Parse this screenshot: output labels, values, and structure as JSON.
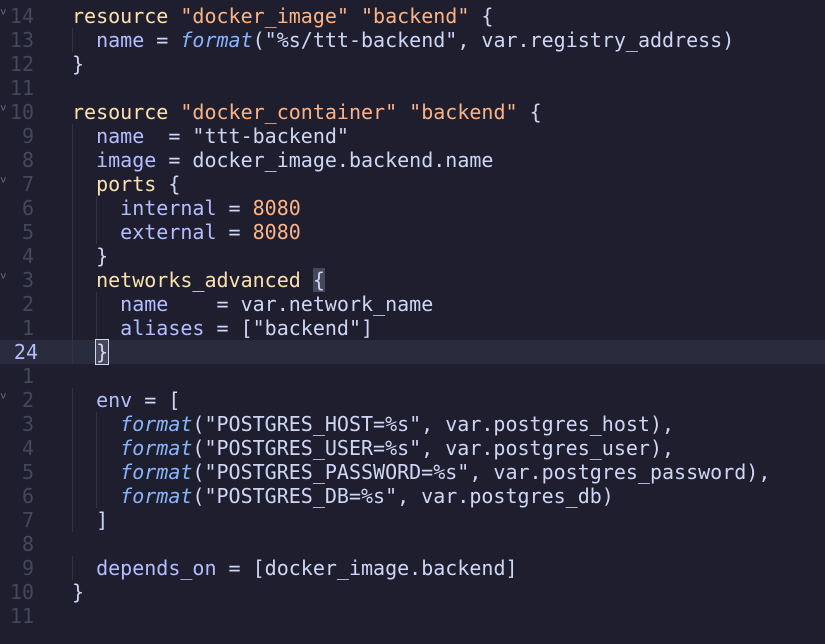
{
  "editor": {
    "current_line_index": 14,
    "lines": [
      {
        "num": "14",
        "fold": true,
        "indent": 0,
        "tokens": [
          {
            "t": "resource",
            "c": "keyword"
          },
          {
            "t": " "
          },
          {
            "t": "\"docker_image\"",
            "c": "string"
          },
          {
            "t": " "
          },
          {
            "t": "\"backend\"",
            "c": "string"
          },
          {
            "t": " {"
          }
        ]
      },
      {
        "num": "13",
        "fold": false,
        "indent": 1,
        "tokens": [
          {
            "t": "name",
            "c": "property"
          },
          {
            "t": " = "
          },
          {
            "t": "format",
            "c": "function"
          },
          {
            "t": "(\"%s/ttt-backend\", var.registry_address)"
          }
        ]
      },
      {
        "num": "12",
        "fold": false,
        "indent": 0,
        "tokens": [
          {
            "t": "}"
          }
        ]
      },
      {
        "num": "11",
        "fold": false,
        "indent": 0,
        "tokens": []
      },
      {
        "num": "10",
        "fold": true,
        "indent": 0,
        "tokens": [
          {
            "t": "resource",
            "c": "keyword"
          },
          {
            "t": " "
          },
          {
            "t": "\"docker_container\"",
            "c": "string"
          },
          {
            "t": " "
          },
          {
            "t": "\"backend\"",
            "c": "string"
          },
          {
            "t": " {"
          }
        ]
      },
      {
        "num": "9",
        "fold": false,
        "indent": 1,
        "tokens": [
          {
            "t": "name",
            "c": "property"
          },
          {
            "t": "  = \"ttt-backend\""
          }
        ]
      },
      {
        "num": "8",
        "fold": false,
        "indent": 1,
        "tokens": [
          {
            "t": "image",
            "c": "property"
          },
          {
            "t": " = docker_image.backend.name"
          }
        ]
      },
      {
        "num": "7",
        "fold": true,
        "indent": 1,
        "tokens": [
          {
            "t": "ports",
            "c": "keyword"
          },
          {
            "t": " {"
          }
        ]
      },
      {
        "num": "6",
        "fold": false,
        "indent": 2,
        "tokens": [
          {
            "t": "internal",
            "c": "property"
          },
          {
            "t": " = "
          },
          {
            "t": "8080",
            "c": "number"
          }
        ]
      },
      {
        "num": "5",
        "fold": false,
        "indent": 2,
        "tokens": [
          {
            "t": "external",
            "c": "property"
          },
          {
            "t": " = "
          },
          {
            "t": "8080",
            "c": "number"
          }
        ]
      },
      {
        "num": "4",
        "fold": false,
        "indent": 1,
        "tokens": [
          {
            "t": "}"
          }
        ]
      },
      {
        "num": "3",
        "fold": true,
        "indent": 1,
        "tokens": [
          {
            "t": "networks_advanced",
            "c": "keyword"
          },
          {
            "t": " "
          },
          {
            "t": "{",
            "c": "bracket-hl"
          }
        ]
      },
      {
        "num": "2",
        "fold": false,
        "indent": 2,
        "tokens": [
          {
            "t": "name",
            "c": "property"
          },
          {
            "t": "    = var.network_name"
          }
        ]
      },
      {
        "num": "1",
        "fold": false,
        "indent": 2,
        "tokens": [
          {
            "t": "aliases",
            "c": "property"
          },
          {
            "t": " = [\"backend\"]"
          }
        ]
      },
      {
        "num": "24",
        "fold": false,
        "indent": 1,
        "tokens": [
          {
            "t": "}",
            "c": "cursor"
          }
        ]
      },
      {
        "num": "1",
        "fold": false,
        "indent": 0,
        "tokens": []
      },
      {
        "num": "2",
        "fold": true,
        "indent": 1,
        "tokens": [
          {
            "t": "env",
            "c": "property"
          },
          {
            "t": " = ["
          }
        ]
      },
      {
        "num": "3",
        "fold": false,
        "indent": 2,
        "tokens": [
          {
            "t": "format",
            "c": "function"
          },
          {
            "t": "(\"POSTGRES_HOST=%s\", var.postgres_host),"
          }
        ]
      },
      {
        "num": "4",
        "fold": false,
        "indent": 2,
        "tokens": [
          {
            "t": "format",
            "c": "function"
          },
          {
            "t": "(\"POSTGRES_USER=%s\", var.postgres_user),"
          }
        ]
      },
      {
        "num": "5",
        "fold": false,
        "indent": 2,
        "tokens": [
          {
            "t": "format",
            "c": "function"
          },
          {
            "t": "(\"POSTGRES_PASSWORD=%s\", var.postgres_password),"
          }
        ]
      },
      {
        "num": "6",
        "fold": false,
        "indent": 2,
        "tokens": [
          {
            "t": "format",
            "c": "function"
          },
          {
            "t": "(\"POSTGRES_DB=%s\", var.postgres_db)"
          }
        ]
      },
      {
        "num": "7",
        "fold": false,
        "indent": 1,
        "tokens": [
          {
            "t": "]"
          }
        ]
      },
      {
        "num": "8",
        "fold": false,
        "indent": 0,
        "tokens": []
      },
      {
        "num": "9",
        "fold": false,
        "indent": 1,
        "tokens": [
          {
            "t": "depends_on",
            "c": "property"
          },
          {
            "t": " = [docker_image.backend]"
          }
        ]
      },
      {
        "num": "10",
        "fold": false,
        "indent": 0,
        "tokens": [
          {
            "t": "}"
          }
        ]
      },
      {
        "num": "11",
        "fold": false,
        "indent": 0,
        "tokens": []
      }
    ],
    "fold_glyph": "˅",
    "colors": {
      "background": "#1e1e2e",
      "current_line": "#2a2b3c",
      "keyword": "#f9e2af",
      "string": "#fab387",
      "property": "#b4befe",
      "function": "#89b4fa",
      "number": "#fab387",
      "line_number": "#45475a",
      "current_line_number": "#b4befe"
    }
  }
}
